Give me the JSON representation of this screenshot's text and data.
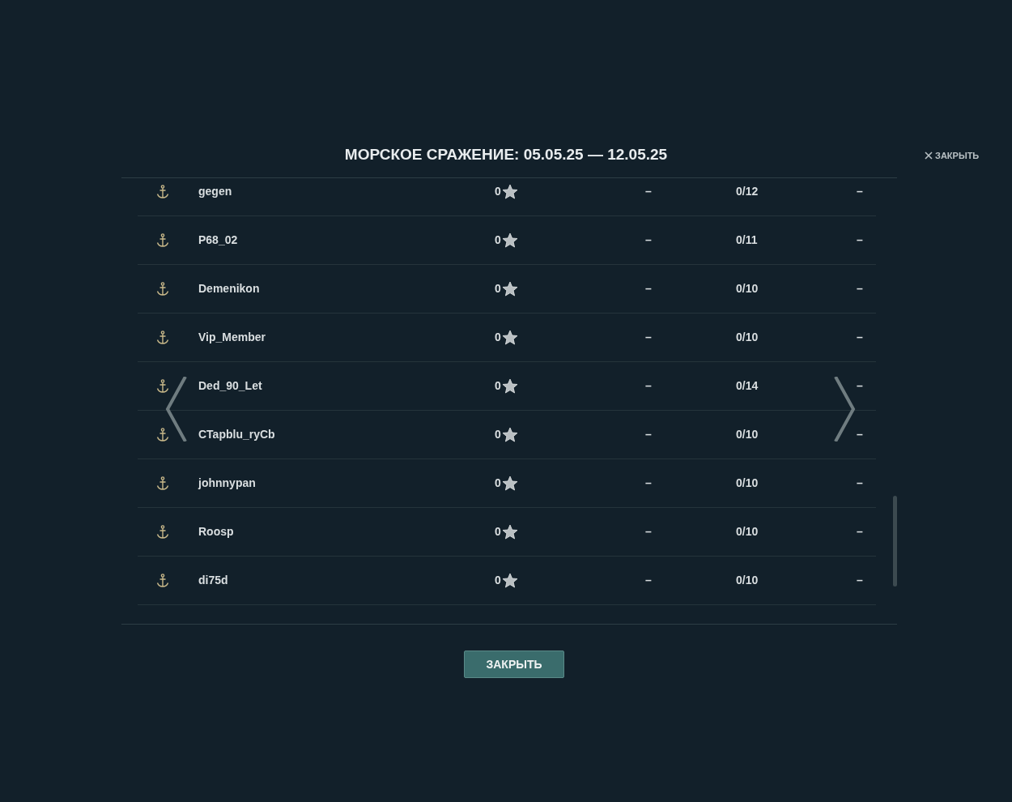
{
  "dialog": {
    "title": "МОРСКОЕ СРАЖЕНИЕ: 05.05.25 — 12.05.25",
    "close_link": "ЗАКРЫТЬ"
  },
  "rows": [
    {
      "name": "gegen",
      "score": "0",
      "column_3": "–",
      "column_4": "0/12",
      "column_5": "–"
    },
    {
      "name": "P68_02",
      "score": "0",
      "column_3": "–",
      "column_4": "0/11",
      "column_5": "–"
    },
    {
      "name": "Demenikon",
      "score": "0",
      "column_3": "–",
      "column_4": "0/10",
      "column_5": "–"
    },
    {
      "name": "Vip_Member",
      "score": "0",
      "column_3": "–",
      "column_4": "0/10",
      "column_5": "–"
    },
    {
      "name": "Ded_90_Let",
      "score": "0",
      "column_3": "–",
      "column_4": "0/14",
      "column_5": "–"
    },
    {
      "name": "CTapblu_ryCb",
      "score": "0",
      "column_3": "–",
      "column_4": "0/10",
      "column_5": "–"
    },
    {
      "name": "johnnypan",
      "score": "0",
      "column_3": "–",
      "column_4": "0/10",
      "column_5": "–"
    },
    {
      "name": "Roosp",
      "score": "0",
      "column_3": "–",
      "column_4": "0/10",
      "column_5": "–"
    },
    {
      "name": "di75d",
      "score": "0",
      "column_3": "–",
      "column_4": "0/10",
      "column_5": "–"
    }
  ],
  "button": "ЗАКРЫТЬ"
}
